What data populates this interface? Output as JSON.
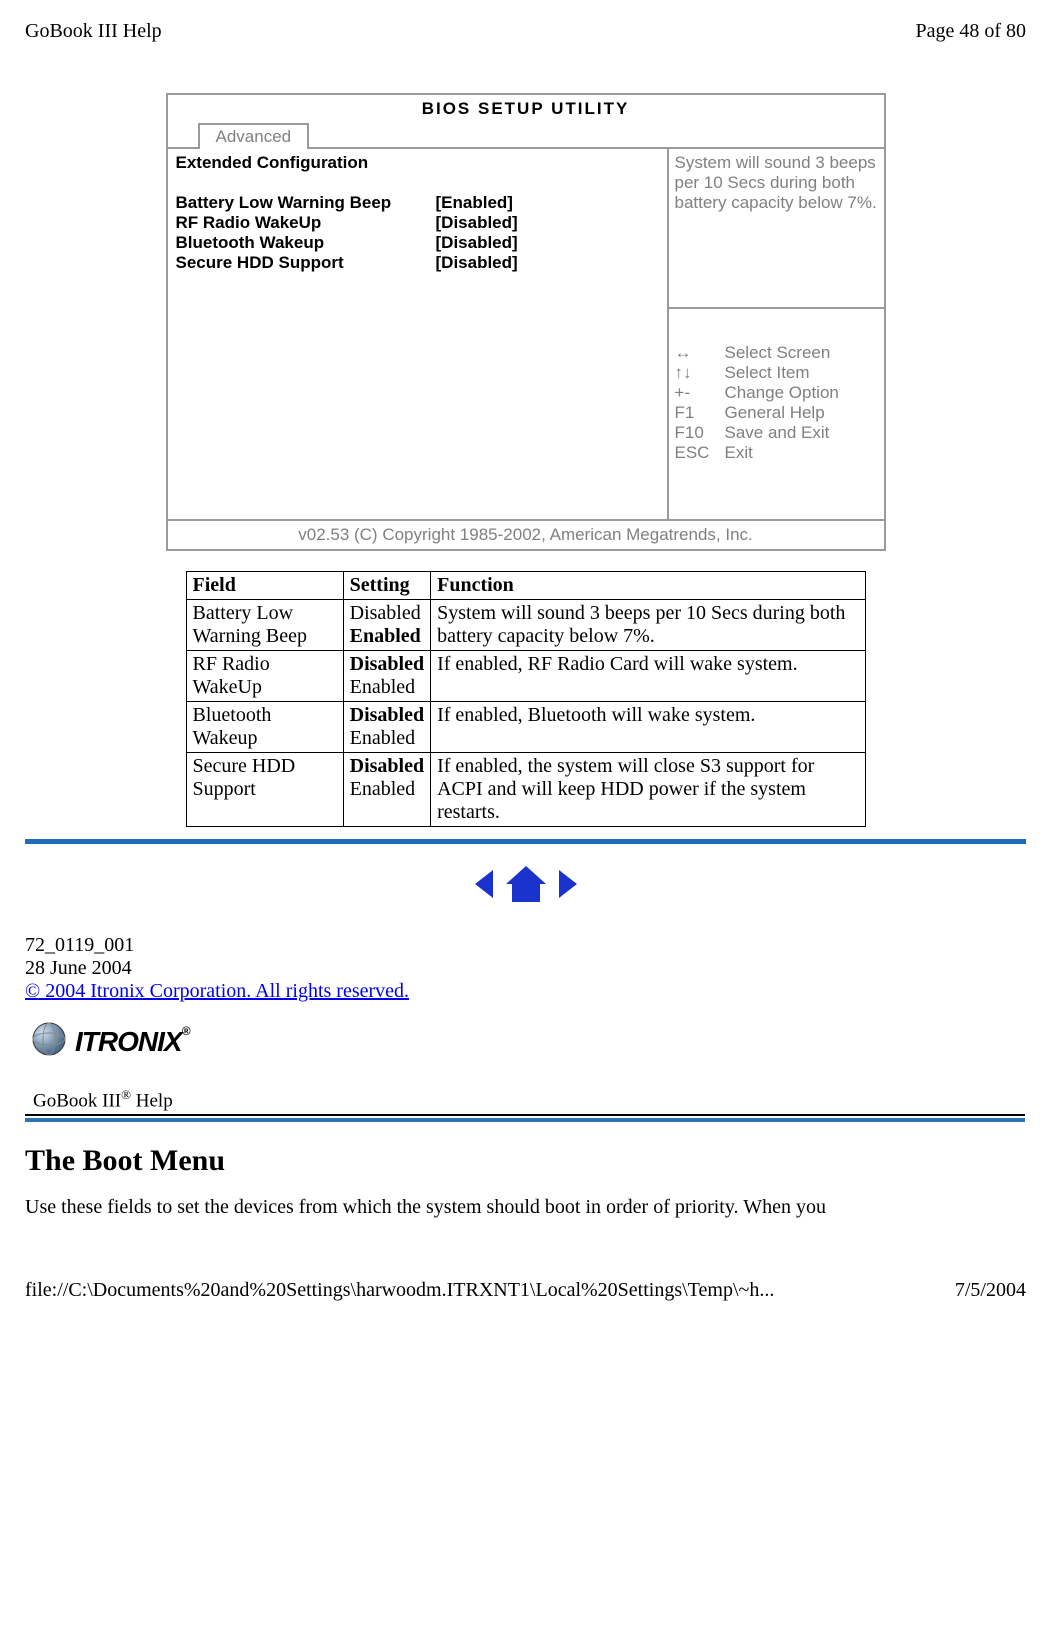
{
  "header": {
    "left": "GoBook III Help",
    "right": "Page 48 of 80"
  },
  "bios": {
    "title": "BIOS   SETUP   UTILITY",
    "tab": "Advanced",
    "section_heading": "Extended Configuration",
    "rows": [
      {
        "label": "Battery Low Warning Beep",
        "value": "[Enabled]"
      },
      {
        "label": "RF Radio WakeUp",
        "value": "[Disabled]"
      },
      {
        "label": "Bluetooth Wakeup",
        "value": "[Disabled]"
      },
      {
        "label": "Secure HDD Support",
        "value": "[Disabled]"
      }
    ],
    "help_text": "System will sound 3 beeps per 10 Secs during both battery capacity below 7%.",
    "keys": [
      {
        "key": "↔",
        "action": "Select Screen"
      },
      {
        "key": "↑↓",
        "action": "Select Item"
      },
      {
        "key": "+-",
        "action": "Change Option"
      },
      {
        "key": "F1",
        "action": "General Help"
      },
      {
        "key": "F10",
        "action": "Save and Exit"
      },
      {
        "key": "ESC",
        "action": "Exit"
      }
    ],
    "footer": "v02.53 (C) Copyright 1985-2002, American Megatrends, Inc."
  },
  "table": {
    "headers": [
      "Field",
      "Setting",
      "Function"
    ],
    "rows": [
      {
        "field": "Battery Low Warning Beep",
        "setting_plain": "Disabled",
        "setting_bold": "Enabled",
        "function": "System will sound 3 beeps per 10 Secs during both battery capacity below 7%."
      },
      {
        "field": "RF Radio WakeUp",
        "setting_bold": "Disabled",
        "setting_plain": "Enabled",
        "function": "If enabled, RF Radio Card will wake system."
      },
      {
        "field": "Bluetooth Wakeup",
        "setting_bold": "Disabled",
        "setting_plain": "Enabled",
        "function": "If enabled, Bluetooth will wake system."
      },
      {
        "field": "Secure HDD Support",
        "setting_bold": "Disabled",
        "setting_plain": "Enabled",
        "function": "If enabled, the system will close S3 support for ACPI and will keep HDD power if the system restarts."
      }
    ]
  },
  "docinfo": {
    "id": "72_0119_001",
    "date": "28 June 2004",
    "copyright": "© 2004 Itronix Corporation.  All rights reserved."
  },
  "brand": {
    "name": "ITRONIX",
    "help_label_prefix": "GoBook III",
    "help_label_suffix": " Help",
    "reg": "®"
  },
  "section": {
    "heading": "The Boot Menu",
    "body": "Use these fields to set the devices from which the system should boot in order of priority. When you"
  },
  "footer": {
    "path": "file://C:\\Documents%20and%20Settings\\harwoodm.ITRXNT1\\Local%20Settings\\Temp\\~h...",
    "date": "7/5/2004"
  }
}
